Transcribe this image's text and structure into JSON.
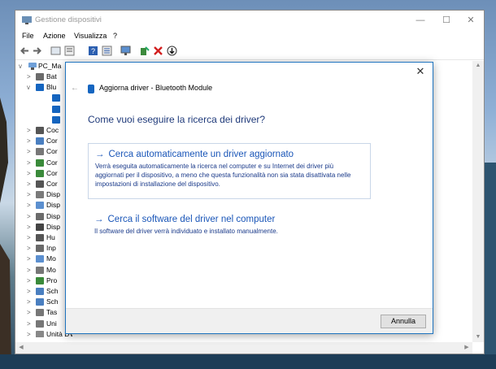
{
  "window": {
    "title": "Gestione dispositivi",
    "controls": [
      "minimize",
      "maximize",
      "close"
    ]
  },
  "menubar": {
    "items": [
      "File",
      "Azione",
      "Visualizza",
      "?"
    ]
  },
  "toolbar": {
    "buttons": [
      "back-icon",
      "forward-icon",
      "properties-icon",
      "view-icon",
      "help-icon",
      "resources-icon",
      "monitor-icon",
      "enable-icon",
      "uninstall-icon",
      "update-driver-icon"
    ]
  },
  "tree": {
    "root": "PC_Ma",
    "rows": [
      {
        "label": "Bat",
        "chev": ">"
      },
      {
        "label": "Blu",
        "chev": "v"
      },
      {
        "label": "",
        "chev": ""
      },
      {
        "label": "",
        "chev": ""
      },
      {
        "label": "",
        "chev": ""
      },
      {
        "label": "Coc",
        "chev": ">"
      },
      {
        "label": "Cor",
        "chev": ">"
      },
      {
        "label": "Cor",
        "chev": ">"
      },
      {
        "label": "Cor",
        "chev": ">"
      },
      {
        "label": "Cor",
        "chev": ">"
      },
      {
        "label": "Cor",
        "chev": ">"
      },
      {
        "label": "Disp",
        "chev": ">"
      },
      {
        "label": "Disp",
        "chev": ">"
      },
      {
        "label": "Disp",
        "chev": ">"
      },
      {
        "label": "Disp",
        "chev": ">"
      },
      {
        "label": "Hu",
        "chev": ">"
      },
      {
        "label": "Inp",
        "chev": ">"
      },
      {
        "label": "Mo",
        "chev": ">"
      },
      {
        "label": "Mo",
        "chev": ">"
      },
      {
        "label": "Pro",
        "chev": ">"
      },
      {
        "label": "Sch",
        "chev": ">"
      },
      {
        "label": "Sch",
        "chev": ">"
      },
      {
        "label": "Tas",
        "chev": ">"
      },
      {
        "label": "Uni",
        "chev": ">"
      },
      {
        "label": "Unità DVD/CD-ROM",
        "chev": ">"
      }
    ]
  },
  "dialog": {
    "title": "Aggiorna driver - Bluetooth Module",
    "question": "Come vuoi eseguire la ricerca dei driver?",
    "option1": {
      "title": "Cerca automaticamente un driver aggiornato",
      "description": "Verrà eseguita automaticamente la ricerca nel computer e su Internet dei driver più aggiornati per il dispositivo, a meno che questa funzionalità non sia stata disattivata nelle impostazioni di installazione del dispositivo."
    },
    "option2": {
      "title": "Cerca il software del driver nel computer",
      "description": "Il software del driver verrà individuato e installato manualmente."
    },
    "arrow": "→",
    "cancel_label": "Annulla",
    "close_glyph": "✕",
    "back_glyph": "←"
  },
  "colors": {
    "accent": "#1a56b8",
    "dialog_border": "#1e73be",
    "question": "#1f3a7a"
  }
}
